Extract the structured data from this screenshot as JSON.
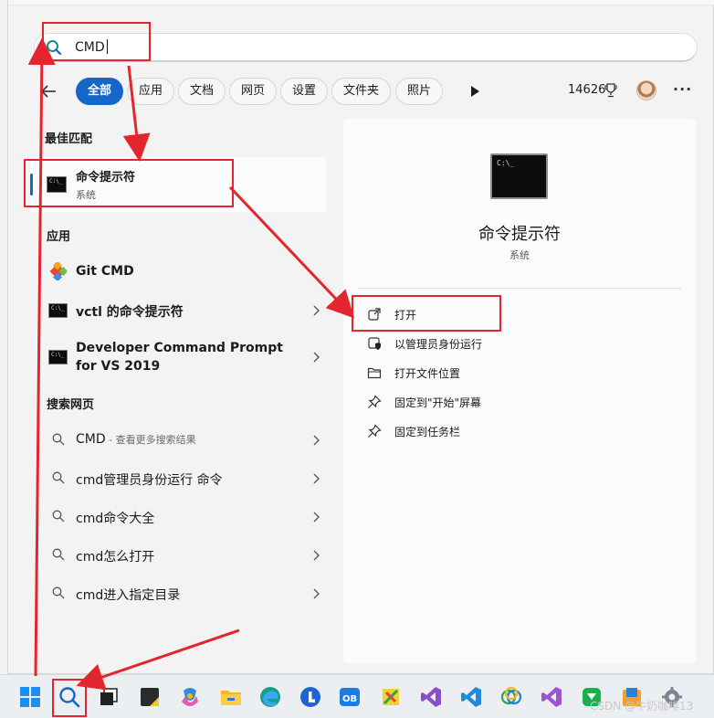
{
  "search": {
    "query": "CMD"
  },
  "filters": {
    "chips": [
      "全部",
      "应用",
      "文档",
      "网页",
      "设置",
      "文件夹",
      "照片"
    ],
    "points": "14626"
  },
  "sections": {
    "best_match": "最佳匹配",
    "apps": "应用",
    "web": "搜索网页"
  },
  "best_match": {
    "title": "命令提示符",
    "subtitle": "系统"
  },
  "apps": [
    {
      "name": "Git CMD"
    },
    {
      "name": "vctl 的命令提示符"
    },
    {
      "name_line1": "Developer Command Prompt",
      "name_line2": "for VS 2019"
    }
  ],
  "web_results": [
    {
      "query": "CMD",
      "hint": " - 查看更多搜索结果"
    },
    {
      "query": "cmd管理员身份运行 命令"
    },
    {
      "query": "cmd命令大全"
    },
    {
      "query": "cmd怎么打开"
    },
    {
      "query": "cmd进入指定目录"
    }
  ],
  "preview": {
    "title": "命令提示符",
    "subtitle": "系统",
    "actions": [
      "打开",
      "以管理员身份运行",
      "打开文件位置",
      "固定到\"开始\"屏幕",
      "固定到任务栏"
    ]
  },
  "watermark": "CSDN @牛奶咖啡13",
  "colors": {
    "accent": "#1466c8",
    "annotation": "#e3262d"
  }
}
